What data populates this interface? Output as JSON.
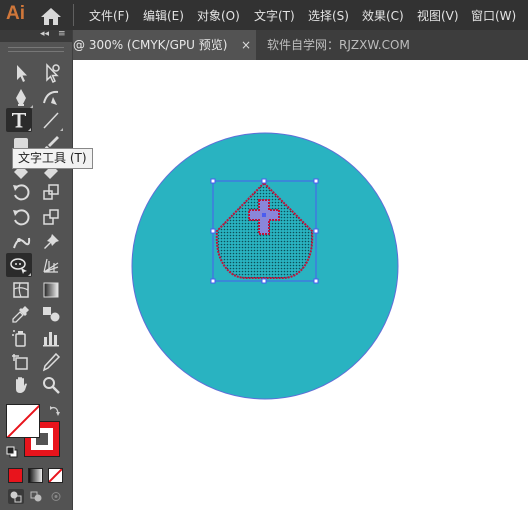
{
  "app": {
    "logo": "Ai",
    "logo_color": "#d0773a"
  },
  "menu": {
    "items": [
      "文件(F)",
      "编辑(E)",
      "对象(O)",
      "文字(T)",
      "选择(S)",
      "效果(C)",
      "视图(V)",
      "窗口(W)"
    ]
  },
  "tabs": {
    "active": "@ 300% (CMYK/GPU 预览)",
    "close": "×",
    "second": "软件自学网：RJZXW.COM"
  },
  "toolbar": {
    "collapse": "◂◂",
    "menu": "≡",
    "tooltip": "文字工具 (T)",
    "tools": [
      "selection-tool",
      "direct-selection-tool",
      "pen-tool",
      "curvature-tool",
      "type-tool",
      "line-segment-tool",
      "rectangle-tool",
      "paintbrush-tool",
      "shaper-tool",
      "eraser-tool",
      "rotate-tool",
      "scale-tool",
      "width-tool",
      "free-transform-tool",
      "puppet-warp-tool",
      "pin-tool",
      "shape-builder-tool",
      "perspective-grid-tool",
      "mesh-tool",
      "gradient-tool",
      "eyedropper-tool",
      "blend-tool",
      "symbol-sprayer-tool",
      "column-graph-tool",
      "artboard-tool",
      "slice-tool",
      "hand-tool",
      "zoom-tool"
    ]
  },
  "colors": {
    "fill": "#ffffff",
    "stroke": "#e8141c",
    "circle": "#29b3c1",
    "circle_stroke": "#5f6dd8",
    "selection": "#4a5cf0",
    "shape_stroke": "#c0133a",
    "cross": "#8a86d9"
  }
}
